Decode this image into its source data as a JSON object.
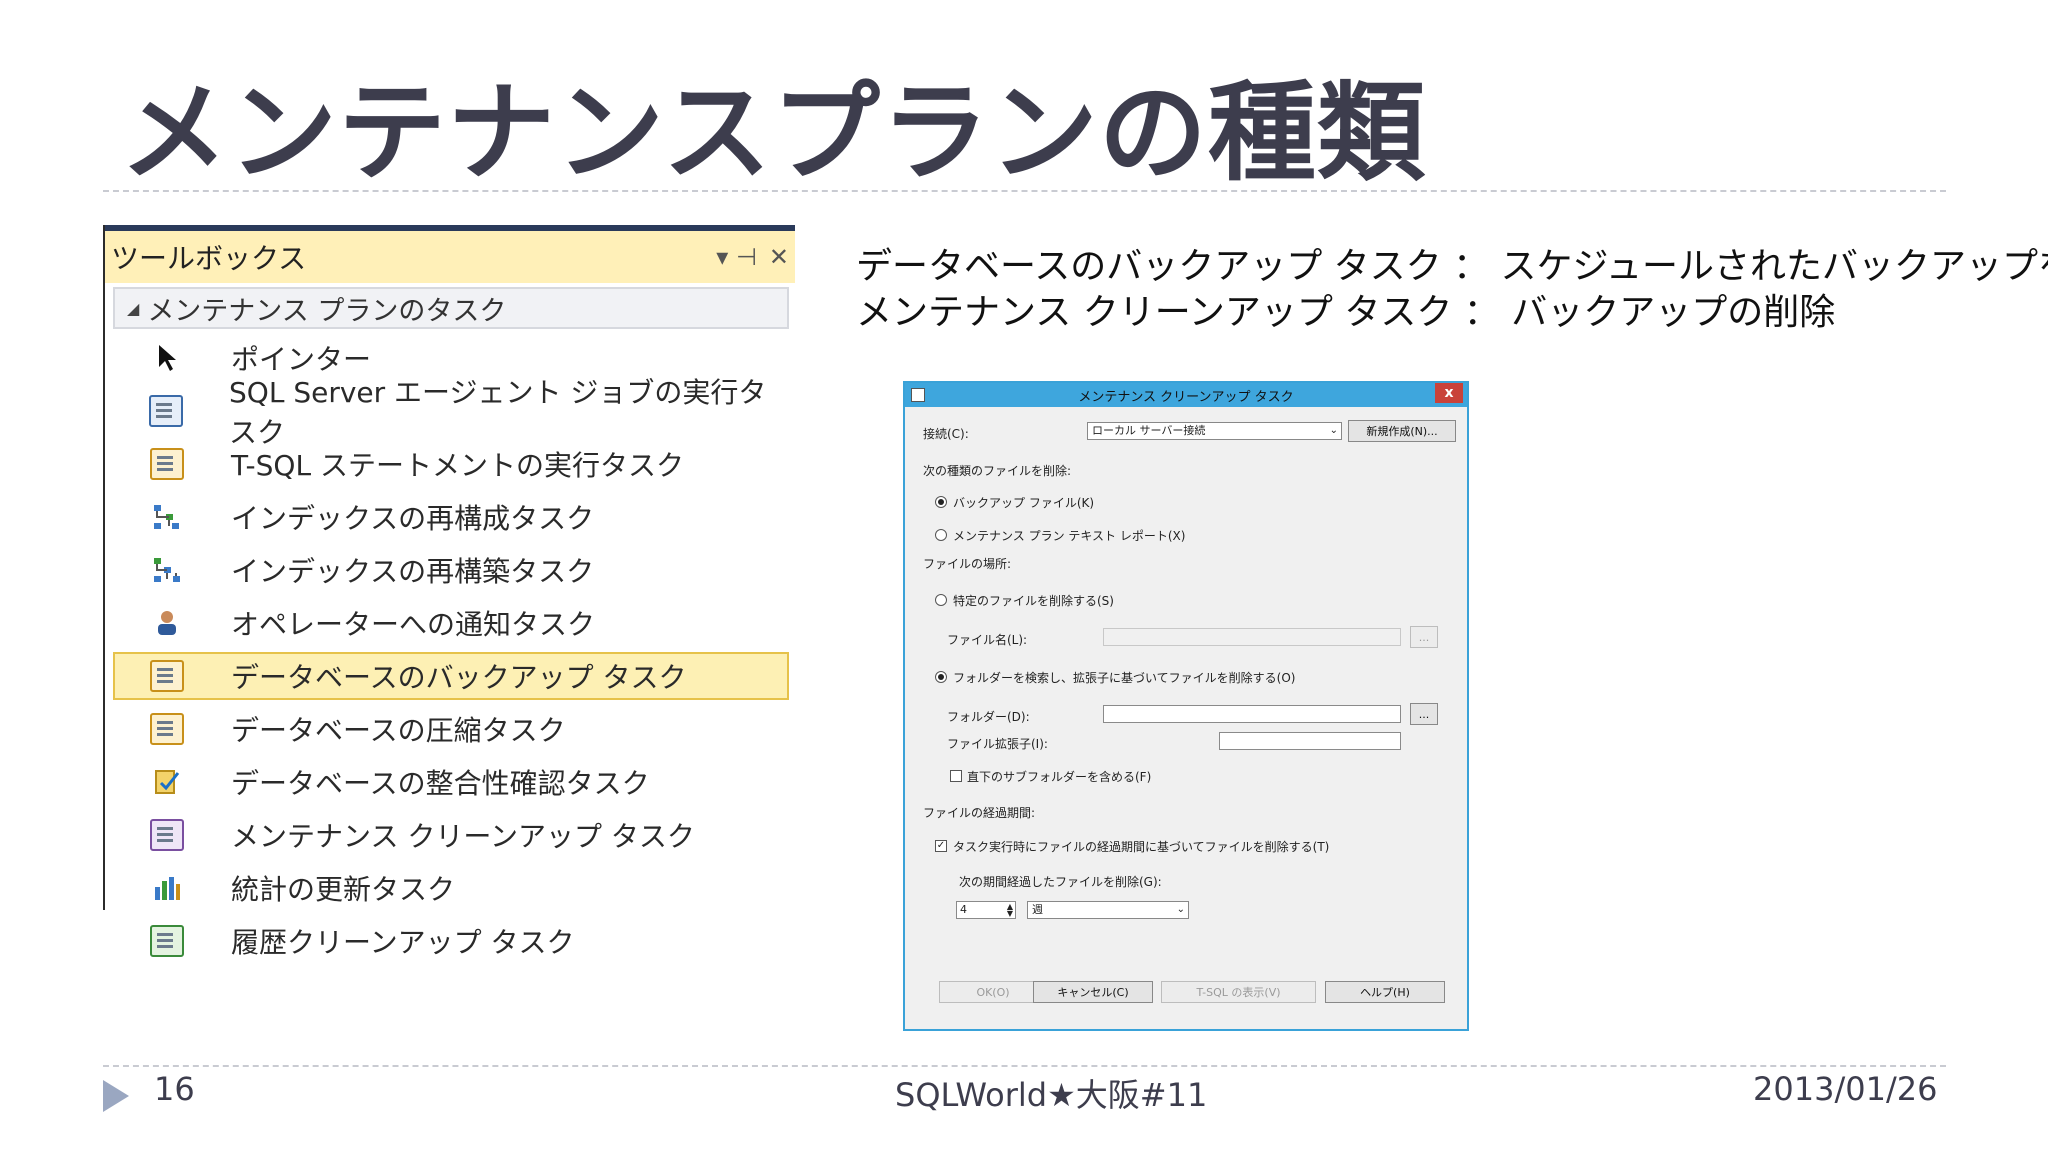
{
  "slide": {
    "title": "メンテナンスプランの種類",
    "page_number": "16",
    "footer_center": "SQLWorld★大阪#11",
    "footer_date": "2013/01/26"
  },
  "toolbox": {
    "title": "ツールボックス",
    "pin_glyph": "▾ ⊣",
    "close_glyph": "✕",
    "group_label": "メンテナンス プランのタスク",
    "items": [
      {
        "label": "ポインター",
        "icon": "pointer-icon"
      },
      {
        "label": "SQL Server エージェント ジョブの実行タスク",
        "icon": "agent-job-icon"
      },
      {
        "label": "T-SQL ステートメントの実行タスク",
        "icon": "tsql-icon"
      },
      {
        "label": "インデックスの再構成タスク",
        "icon": "index-reorganize-icon"
      },
      {
        "label": "インデックスの再構築タスク",
        "icon": "index-rebuild-icon"
      },
      {
        "label": "オペレーターへの通知タスク",
        "icon": "operator-icon"
      },
      {
        "label": "データベースのバックアップ タスク",
        "icon": "backup-icon"
      },
      {
        "label": "データベースの圧縮タスク",
        "icon": "shrink-icon"
      },
      {
        "label": "データベースの整合性確認タスク",
        "icon": "integrity-icon"
      },
      {
        "label": "メンテナンス クリーンアップ タスク",
        "icon": "cleanup-icon"
      },
      {
        "label": "統計の更新タスク",
        "icon": "statistics-icon"
      },
      {
        "label": "履歴クリーンアップ タスク",
        "icon": "history-icon"
      }
    ]
  },
  "description": {
    "line1": "データベースのバックアップ タスク ： スケジュールされたバックアップを取得",
    "line2": "メンテナンス クリーンアップ タスク ： バックアップの削除"
  },
  "dialog": {
    "title": "メンテナンス クリーンアップ タスク",
    "close": "x",
    "connection_label": "接続(C):",
    "connection_value": "ローカル サーバー接続",
    "new_button": "新規作成(N)...",
    "delete_type_label": "次の種類のファイルを削除:",
    "radio_backup": "バックアップ ファイル(K)",
    "radio_report": "メンテナンス プラン テキスト レポート(X)",
    "file_location_label": "ファイルの場所:",
    "radio_specific": "特定のファイルを削除する(S)",
    "file_name_label": "ファイル名(L):",
    "browse": "...",
    "radio_folder": "フォルダーを検索し、拡張子に基づいてファイルを削除する(O)",
    "folder_label": "フォルダー(D):",
    "extension_label": "ファイル拡張子(I):",
    "subfolder_check": "直下のサブフォルダーを含める(F)",
    "age_label": "ファイルの経過期間:",
    "age_check": "タスク実行時にファイルの経過期間に基づいてファイルを削除する(T)",
    "age_older_label": "次の期間経過したファイルを削除(G):",
    "age_value": "4",
    "age_unit": "週",
    "ok": "OK(O)",
    "cancel": "キャンセル(C)",
    "tsql": "T-SQL の表示(V)",
    "help": "ヘルプ(H)"
  }
}
